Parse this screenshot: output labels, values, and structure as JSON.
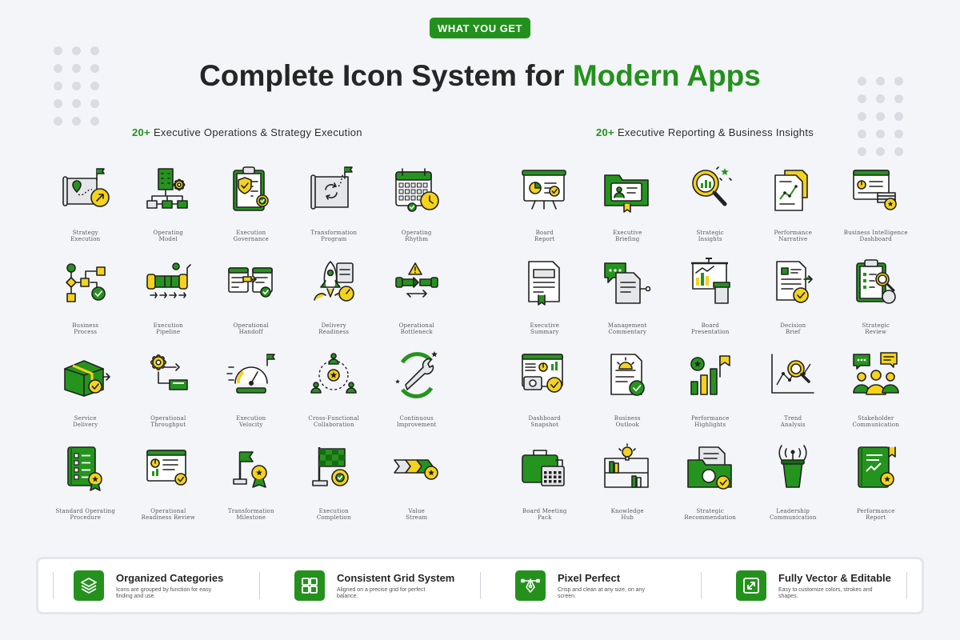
{
  "badge": "WHAT YOU GET",
  "title": {
    "main": "Complete Icon System for",
    "accent": "Modern Apps"
  },
  "colors": {
    "brand_green": "#24911d",
    "accent_yellow": "#f2d21b",
    "background": "#f3f5f8"
  },
  "left_section": {
    "count": "20+",
    "heading": "Executive Operations & Strategy Execution",
    "icons": [
      {
        "icon": "map-flag-icon",
        "line1": "Strategy",
        "line2": "Execution"
      },
      {
        "icon": "org-building-icon",
        "line1": "Operating",
        "line2": "Model"
      },
      {
        "icon": "clipboard-shield-icon",
        "line1": "Execution",
        "line2": "Governance"
      },
      {
        "icon": "roadmap-cycle-icon",
        "line1": "Transformation",
        "line2": "Program"
      },
      {
        "icon": "calendar-clock-icon",
        "line1": "Operating",
        "line2": "Rhythm"
      },
      {
        "icon": "process-flow-icon",
        "line1": "Business",
        "line2": "Process"
      },
      {
        "icon": "pipeline-icon",
        "line1": "Execution",
        "line2": "Pipeline"
      },
      {
        "icon": "handoff-windows-icon",
        "line1": "Operational",
        "line2": "Handoff"
      },
      {
        "icon": "rocket-gauge-icon",
        "line1": "Delivery",
        "line2": "Readiness"
      },
      {
        "icon": "pipe-warning-icon",
        "line1": "Operational",
        "line2": "Bottleneck"
      },
      {
        "icon": "box-delivery-icon",
        "line1": "Service",
        "line2": "Delivery"
      },
      {
        "icon": "gear-tray-icon",
        "line1": "Operational",
        "line2": "Throughput"
      },
      {
        "icon": "speedometer-icon",
        "line1": "Execution",
        "line2": "Velocity"
      },
      {
        "icon": "team-star-icon",
        "line1": "Cross-Functional",
        "line2": "Collaboration"
      },
      {
        "icon": "wrench-cycle-icon",
        "line1": "Continuous",
        "line2": "Improvement"
      },
      {
        "icon": "checklist-book-icon",
        "line1": "Standard Operating",
        "line2": "Procedure"
      },
      {
        "icon": "readiness-screen-icon",
        "line1": "Operational",
        "line2": "Readiness Review"
      },
      {
        "icon": "milestone-flag-icon",
        "line1": "Transformation",
        "line2": "Milestone"
      },
      {
        "icon": "finish-flag-icon",
        "line1": "Execution",
        "line2": "Completion"
      },
      {
        "icon": "chevron-stream-icon",
        "line1": "Value",
        "line2": "Stream"
      }
    ]
  },
  "right_section": {
    "count": "20+",
    "heading": "Executive Reporting & Business Insights",
    "icons": [
      {
        "icon": "presentation-board-icon",
        "line1": "Board",
        "line2": "Report"
      },
      {
        "icon": "folder-profile-icon",
        "line1": "Executive",
        "line2": "Briefing"
      },
      {
        "icon": "magnifier-chart-icon",
        "line1": "Strategic",
        "line2": "Insights"
      },
      {
        "icon": "document-trend-icon",
        "line1": "Performance",
        "line2": "Narrative"
      },
      {
        "icon": "dashboard-stack-icon",
        "line1": "Business Intelligence",
        "line2": "Dashboard"
      },
      {
        "icon": "document-bookmark-icon",
        "line1": "Executive",
        "line2": "Summary"
      },
      {
        "icon": "chat-document-icon",
        "line1": "Management",
        "line2": "Commentary"
      },
      {
        "icon": "presentation-podium-icon",
        "line1": "Board",
        "line2": "Presentation"
      },
      {
        "icon": "brief-check-icon",
        "line1": "Decision",
        "line2": "Brief"
      },
      {
        "icon": "review-clipboard-icon",
        "line1": "Strategic",
        "line2": "Review"
      },
      {
        "icon": "dashboard-camera-icon",
        "line1": "Dashboard",
        "line2": "Snapshot"
      },
      {
        "icon": "document-sunrise-icon",
        "line1": "Business",
        "line2": "Outlook"
      },
      {
        "icon": "bar-star-icon",
        "line1": "Performance",
        "line2": "Highlights"
      },
      {
        "icon": "trend-magnifier-icon",
        "line1": "Trend",
        "line2": "Analysis"
      },
      {
        "icon": "people-chat-icon",
        "line1": "Stakeholder",
        "line2": "Communication"
      },
      {
        "icon": "briefcase-calendar-icon",
        "line1": "Board Meeting",
        "line2": "Pack"
      },
      {
        "icon": "bookshelf-bulb-icon",
        "line1": "Knowledge",
        "line2": "Hub"
      },
      {
        "icon": "folder-compass-icon",
        "line1": "Strategic",
        "line2": "Recommendation"
      },
      {
        "icon": "podium-broadcast-icon",
        "line1": "Leadership",
        "line2": "Communication"
      },
      {
        "icon": "report-book-icon",
        "line1": "Performance",
        "line2": "Report"
      }
    ]
  },
  "features": [
    {
      "icon": "layers-icon",
      "title": "Organized Categories",
      "desc": "Icons are grouped by function for easy finding and use."
    },
    {
      "icon": "grid-icon",
      "title": "Consistent Grid System",
      "desc": "Aligned on a precise grid for perfect balance."
    },
    {
      "icon": "pen-tool-icon",
      "title": "Pixel Perfect",
      "desc": "Crisp and clean at any size, on any screen."
    },
    {
      "icon": "resize-icon",
      "title": "Fully Vector & Editable",
      "desc": "Easy to customize colors, strokes and shapes."
    }
  ]
}
